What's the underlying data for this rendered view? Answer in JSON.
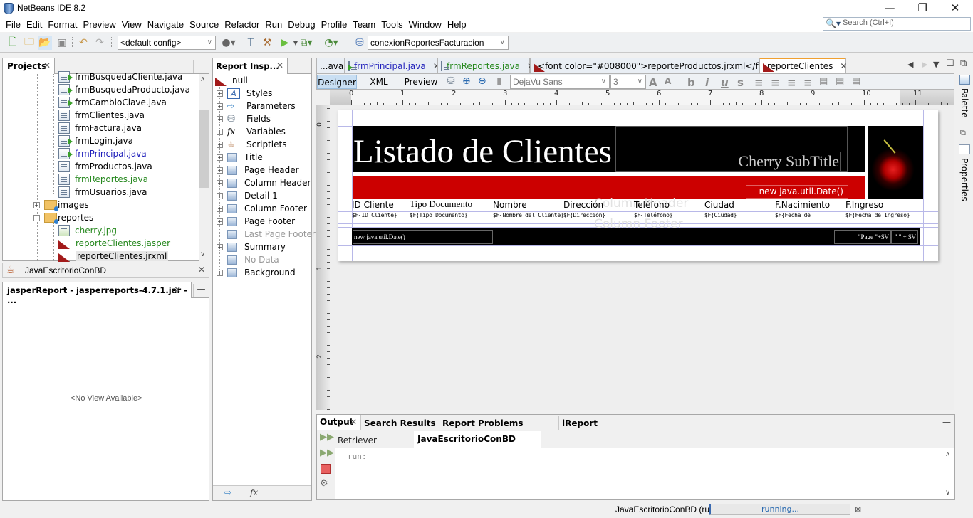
{
  "window": {
    "title": "NetBeans IDE 8.2",
    "controls": {
      "minimize": "—",
      "restore": "❐",
      "close": "✕"
    }
  },
  "menu": [
    "File",
    "Edit",
    "Format",
    "Preview",
    "View",
    "Navigate",
    "Source",
    "Refactor",
    "Run",
    "Debug",
    "Profile",
    "Team",
    "Tools",
    "Window",
    "Help"
  ],
  "search": {
    "placeholder": "Search (Ctrl+I)",
    "icon": "search-icon"
  },
  "toolbar": {
    "config_select": "<default config>",
    "connection_select": "conexionReportesFacturacion"
  },
  "projects": {
    "tab_label": "Projects",
    "items": [
      {
        "label": "frmBusquedaCliente.java",
        "type": "runnable",
        "color": "normal"
      },
      {
        "label": "frmBusquedaProducto.java",
        "type": "runnable",
        "color": "normal"
      },
      {
        "label": "frmCambioClave.java",
        "type": "runnable",
        "color": "normal"
      },
      {
        "label": "frmClientes.java",
        "type": "file",
        "color": "normal"
      },
      {
        "label": "frmFactura.java",
        "type": "file",
        "color": "normal"
      },
      {
        "label": "frmLogin.java",
        "type": "runnable",
        "color": "normal"
      },
      {
        "label": "frmPrincipal.java",
        "type": "runnable",
        "color": "modified"
      },
      {
        "label": "frmProductos.java",
        "type": "file",
        "color": "normal"
      },
      {
        "label": "frmReportes.java",
        "type": "file",
        "color": "new"
      },
      {
        "label": "frmUsuarios.java",
        "type": "file",
        "color": "normal"
      }
    ],
    "folders": [
      {
        "label": "images",
        "expanded": false
      },
      {
        "label": "reportes",
        "expanded": true
      }
    ],
    "report_items": [
      {
        "label": "cherry.jpg",
        "color": "new"
      },
      {
        "label": "reporteClientes.jasper",
        "color": "new"
      },
      {
        "label": "reporteClientes.jrxml",
        "color": "normal",
        "selected": true
      }
    ],
    "project_bar": "JavaEscritorioConBD"
  },
  "navigator": {
    "tab_label": "jasperReport - jasperreports-4.7.1.jar - ...",
    "empty_text": "<No View Available>"
  },
  "inspector": {
    "tab_label": "Report Insp...",
    "root": "null",
    "items": [
      {
        "label": "Styles",
        "icon": "styles-icon",
        "enabled": true
      },
      {
        "label": "Parameters",
        "icon": "parameters-icon",
        "enabled": true
      },
      {
        "label": "Fields",
        "icon": "fields-icon",
        "enabled": true
      },
      {
        "label": "Variables",
        "icon": "variables-icon",
        "enabled": true
      },
      {
        "label": "Scriptlets",
        "icon": "scriptlets-icon",
        "enabled": true
      },
      {
        "label": "Title",
        "icon": "band-icon",
        "enabled": true
      },
      {
        "label": "Page Header",
        "icon": "band-icon",
        "enabled": true
      },
      {
        "label": "Column Header",
        "icon": "band-icon",
        "enabled": true
      },
      {
        "label": "Detail 1",
        "icon": "band-icon",
        "enabled": true
      },
      {
        "label": "Column Footer",
        "icon": "band-icon",
        "enabled": true
      },
      {
        "label": "Page Footer",
        "icon": "band-icon",
        "enabled": true
      },
      {
        "label": "Last Page Footer",
        "icon": "band-icon",
        "enabled": false
      },
      {
        "label": "Summary",
        "icon": "band-icon",
        "enabled": true
      },
      {
        "label": "No Data",
        "icon": "band-icon",
        "enabled": false
      },
      {
        "label": "Background",
        "icon": "band-icon",
        "enabled": true
      }
    ]
  },
  "editor": {
    "tabs": [
      {
        "label": "...ava",
        "color": "normal"
      },
      {
        "label": "frmPrincipal.java",
        "color": "modified"
      },
      {
        "label": "frmReportes.java",
        "color": "new"
      },
      {
        "label": "<font color=\"#008000\">reporteProductos.jrxml</font>",
        "color": "normal"
      },
      {
        "label": "reporteClientes",
        "color": "normal",
        "active": true
      }
    ],
    "views": [
      "Designer",
      "XML",
      "Preview"
    ],
    "active_view": "Designer",
    "font_select": "DejaVu Sans",
    "size_select": "3",
    "ruler_ticks": [
      "0",
      "1",
      "2",
      "3",
      "4",
      "5",
      "6",
      "7",
      "8",
      "9",
      "10",
      "11"
    ],
    "vruler_ticks": [
      "0",
      "1",
      "2",
      "3"
    ]
  },
  "report": {
    "title": "Listado de Clientes",
    "subtitle": "Cherry SubTitle",
    "title_date": "new java.util.Date()",
    "band_watermark_header": "Column Header",
    "band_watermark_footer": "Column Footer",
    "columns": [
      {
        "header": "ID Cliente",
        "field": "$F{ID Cliente}"
      },
      {
        "header": "Tipo Documento",
        "field": "$F{Tipo Documento}"
      },
      {
        "header": "Nombre",
        "field": "$F{Nombre del Cliente}"
      },
      {
        "header": "Dirección",
        "field": "$F{Dirección}"
      },
      {
        "header": "Teléfono",
        "field": "$F{Teléfono}"
      },
      {
        "header": "Ciudad",
        "field": "$F{Ciudad}"
      },
      {
        "header": "F.Nacimiento",
        "field": "$F{Fecha de"
      },
      {
        "header": "F.Ingreso",
        "field": "$F{Fecha de Ingreso}"
      }
    ],
    "footer_date": "new java.util.Date()",
    "footer_page": "\"Page \"+$V",
    "footer_page2": "\" \" + $V",
    "colors": {
      "banner": "#000000",
      "stripe": "#cc0000"
    }
  },
  "rightbar": {
    "palette": "Palette",
    "properties": "Properties"
  },
  "output": {
    "tabs": [
      "Output",
      "Search Results",
      "Report Problems Window",
      "iReport output"
    ],
    "subtabs": [
      "Retriever Output",
      "JavaEscritorioConBD (run)"
    ],
    "active_subtab": "JavaEscritorioConBD (run)",
    "text": "run:"
  },
  "status": {
    "task": "JavaEscritorioConBD (run)",
    "progress_text": "running..."
  }
}
